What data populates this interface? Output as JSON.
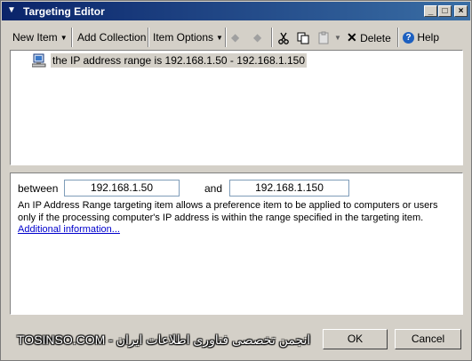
{
  "window": {
    "title": "Targeting Editor"
  },
  "toolbar": {
    "new_item": "New Item",
    "new_item_mnemonic": "N",
    "new_item_rest": "ew Item",
    "add_collection": "Add Collection",
    "item_options": "Item Options",
    "delete": "Delete",
    "help": "Help"
  },
  "tree": {
    "items": [
      {
        "label": "the IP address range is 192.168.1.50 - 192.168.1.150",
        "icon": "network-computer-icon"
      }
    ]
  },
  "properties": {
    "between_label": "between",
    "start_ip": "192.168.1.50",
    "and_label": "and",
    "end_ip": "192.168.1.150",
    "description": "An IP Address Range targeting item allows a preference item to be applied to computers or users only if the processing computer's IP address is within the range specified in the targeting item.",
    "link": "Additional information..."
  },
  "buttons": {
    "ok": "OK",
    "cancel": "Cancel"
  },
  "watermark": "TOSINSO.COM - انجمن تخصصی فناوری اطلاعات ایران"
}
